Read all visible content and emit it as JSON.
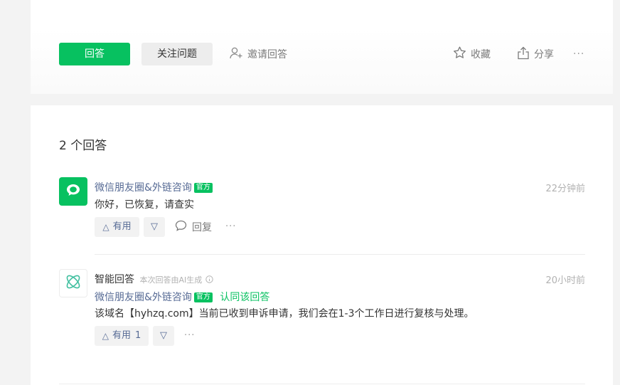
{
  "toolbar": {
    "answer_label": "回答",
    "follow_label": "关注问题",
    "invite_label": "邀请回答",
    "favorite_label": "收藏",
    "share_label": "分享",
    "more_label": "···"
  },
  "answers_section": {
    "count_label": "2 个回答"
  },
  "answers": [
    {
      "author": "微信朋友圈&外链咨询",
      "badge": "官方",
      "time": "22分钟前",
      "content": "你好，已恢复，请查实",
      "useful_label": "有用",
      "down_label": "▽",
      "reply_label": "回复",
      "more_label": "···"
    },
    {
      "ai_label": "智能回答",
      "ai_note": "本次回答由AI生成",
      "time": "20小时前",
      "endorser": "微信朋友圈&外链咨询",
      "badge": "官方",
      "endorse_label": "认同该回答",
      "content": "该域名【hyhzq.com】当前已收到申诉申请，我们会在1-3个工作日进行复核与处理。",
      "useful_label": "有用",
      "useful_count": "1",
      "down_label": "▽",
      "more_label": "···"
    }
  ],
  "colors": {
    "accent": "#07c160",
    "link": "#576b95",
    "muted": "#b2b2b2"
  }
}
